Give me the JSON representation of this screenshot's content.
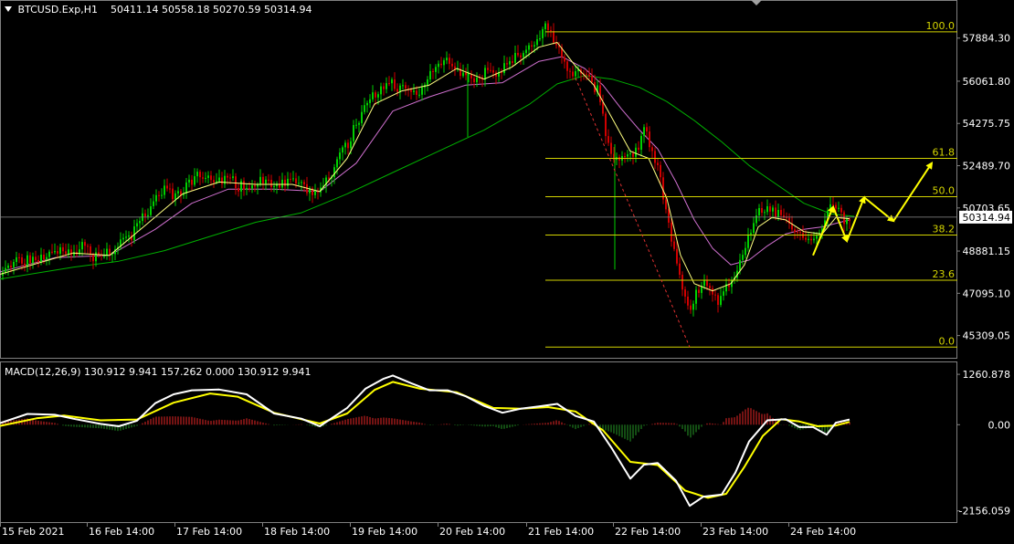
{
  "header": {
    "symbol_text": "BTCUSD.Exp,H1",
    "ohlc_text": "50411.14 50558.18 50270.59 50314.94"
  },
  "macd_header": {
    "text": "MACD(12,26,9) 130.912 9.941 157.262 0.000 130.912 9.941"
  },
  "colors": {
    "background": "#000000",
    "bull": "#00d000",
    "bear": "#d00000",
    "fib": "#d4d400",
    "ma_fast": "#ffff80",
    "ma_mid": "#d070d0",
    "ma_slow": "#00b000",
    "macd_line": "#ffffff",
    "signal_line": "#ffff00",
    "hist_pos": "#c02020",
    "hist_neg": "#208020",
    "grid_border": "#808080",
    "arrow": "#ffff00"
  },
  "chart_data": [
    {
      "type": "line",
      "name": "price",
      "ylim": [
        44600,
        58800
      ],
      "y_ticks": [
        "57884.30",
        "56061.80",
        "54275.75",
        "52489.70",
        "50703.65",
        "48881.15",
        "47095.10",
        "45309.05"
      ],
      "current_price": "50314.94",
      "x_tick_labels": [
        "15 Feb 2021",
        "16 Feb 14:00",
        "17 Feb 14:00",
        "18 Feb 14:00",
        "19 Feb 14:00",
        "20 Feb 14:00",
        "21 Feb 14:00",
        "22 Feb 14:00",
        "23 Feb 14:00",
        "24 Feb 14:00"
      ],
      "price_path": [
        [
          0,
          47800
        ],
        [
          10,
          48300
        ],
        [
          20,
          48600
        ],
        [
          30,
          48450
        ],
        [
          40,
          48350
        ],
        [
          50,
          48800
        ],
        [
          60,
          49050
        ],
        [
          70,
          48950
        ],
        [
          80,
          48850
        ],
        [
          90,
          49100
        ],
        [
          100,
          48700
        ],
        [
          110,
          48550
        ],
        [
          120,
          48850
        ],
        [
          130,
          49200
        ],
        [
          140,
          49350
        ],
        [
          150,
          49850
        ],
        [
          160,
          50500
        ],
        [
          170,
          51100
        ],
        [
          180,
          51400
        ],
        [
          190,
          51250
        ],
        [
          200,
          51450
        ],
        [
          210,
          51800
        ],
        [
          220,
          52100
        ],
        [
          230,
          51850
        ],
        [
          240,
          51900
        ],
        [
          250,
          51950
        ],
        [
          260,
          51650
        ],
        [
          270,
          51600
        ],
        [
          280,
          51750
        ],
        [
          290,
          51900
        ],
        [
          300,
          51800
        ],
        [
          310,
          51650
        ],
        [
          320,
          51750
        ],
        [
          330,
          51600
        ],
        [
          340,
          51300
        ],
        [
          350,
          51550
        ],
        [
          360,
          52000
        ],
        [
          370,
          52700
        ],
        [
          380,
          53400
        ],
        [
          390,
          54200
        ],
        [
          400,
          55000
        ],
        [
          410,
          55500
        ],
        [
          420,
          55800
        ],
        [
          430,
          56000
        ],
        [
          440,
          55700
        ],
        [
          450,
          55500
        ],
        [
          460,
          55700
        ],
        [
          470,
          56300
        ],
        [
          480,
          56700
        ],
        [
          490,
          56850
        ],
        [
          500,
          56600
        ],
        [
          510,
          56100
        ],
        [
          520,
          56250
        ],
        [
          530,
          56400
        ],
        [
          540,
          56500
        ],
        [
          550,
          56550
        ],
        [
          560,
          56900
        ],
        [
          570,
          57300
        ],
        [
          580,
          57500
        ],
        [
          590,
          57800
        ],
        [
          597,
          58300
        ],
        [
          605,
          57850
        ],
        [
          615,
          57100
        ],
        [
          625,
          56500
        ],
        [
          635,
          56250
        ],
        [
          645,
          56200
        ],
        [
          655,
          55600
        ],
        [
          665,
          53500
        ],
        [
          675,
          52700
        ],
        [
          685,
          53100
        ],
        [
          695,
          52900
        ],
        [
          705,
          53900
        ],
        [
          715,
          53200
        ],
        [
          725,
          51500
        ],
        [
          735,
          49500
        ],
        [
          745,
          47500
        ],
        [
          755,
          46500
        ],
        [
          765,
          47200
        ],
        [
          775,
          47700
        ],
        [
          785,
          46800
        ],
        [
          795,
          47400
        ],
        [
          805,
          47900
        ],
        [
          815,
          49000
        ],
        [
          825,
          50300
        ],
        [
          835,
          50800
        ],
        [
          845,
          50600
        ],
        [
          855,
          50400
        ],
        [
          865,
          50100
        ],
        [
          875,
          49700
        ],
        [
          885,
          49500
        ],
        [
          895,
          49300
        ],
        [
          905,
          50600
        ],
        [
          915,
          50700
        ],
        [
          925,
          50000
        ],
        [
          935,
          50300
        ]
      ],
      "ma_fast_path": [
        [
          0,
          47900
        ],
        [
          40,
          48350
        ],
        [
          80,
          48800
        ],
        [
          120,
          48700
        ],
        [
          160,
          50000
        ],
        [
          200,
          51300
        ],
        [
          240,
          51800
        ],
        [
          280,
          51700
        ],
        [
          320,
          51700
        ],
        [
          350,
          51400
        ],
        [
          380,
          52800
        ],
        [
          410,
          55100
        ],
        [
          440,
          55650
        ],
        [
          470,
          55900
        ],
        [
          500,
          56600
        ],
        [
          530,
          56150
        ],
        [
          560,
          56650
        ],
        [
          590,
          57500
        ],
        [
          610,
          57700
        ],
        [
          630,
          56700
        ],
        [
          650,
          55900
        ],
        [
          670,
          54500
        ],
        [
          690,
          53100
        ],
        [
          710,
          52800
        ],
        [
          730,
          51100
        ],
        [
          745,
          48700
        ],
        [
          760,
          47500
        ],
        [
          780,
          47200
        ],
        [
          800,
          47500
        ],
        [
          815,
          48300
        ],
        [
          830,
          49900
        ],
        [
          845,
          50300
        ],
        [
          860,
          50200
        ],
        [
          880,
          49700
        ],
        [
          900,
          49600
        ],
        [
          915,
          50300
        ],
        [
          930,
          50250
        ]
      ],
      "ma_mid_path": [
        [
          0,
          48000
        ],
        [
          60,
          48600
        ],
        [
          120,
          48700
        ],
        [
          170,
          49800
        ],
        [
          210,
          50900
        ],
        [
          250,
          51500
        ],
        [
          300,
          51500
        ],
        [
          350,
          51400
        ],
        [
          390,
          52600
        ],
        [
          430,
          54800
        ],
        [
          470,
          55400
        ],
        [
          510,
          55900
        ],
        [
          550,
          56000
        ],
        [
          590,
          56900
        ],
        [
          615,
          57100
        ],
        [
          640,
          56600
        ],
        [
          660,
          55900
        ],
        [
          680,
          54900
        ],
        [
          700,
          54000
        ],
        [
          720,
          53200
        ],
        [
          740,
          51800
        ],
        [
          760,
          50200
        ],
        [
          780,
          49000
        ],
        [
          800,
          48300
        ],
        [
          820,
          48500
        ],
        [
          840,
          49100
        ],
        [
          860,
          49600
        ],
        [
          880,
          49800
        ],
        [
          900,
          49900
        ],
        [
          930,
          50200
        ]
      ],
      "ma_slow_path": [
        [
          0,
          47700
        ],
        [
          80,
          48200
        ],
        [
          130,
          48450
        ],
        [
          180,
          48900
        ],
        [
          230,
          49500
        ],
        [
          280,
          50100
        ],
        [
          330,
          50500
        ],
        [
          380,
          51300
        ],
        [
          430,
          52200
        ],
        [
          480,
          53100
        ],
        [
          530,
          54000
        ],
        [
          580,
          55100
        ],
        [
          610,
          55950
        ],
        [
          640,
          56300
        ],
        [
          670,
          56150
        ],
        [
          700,
          55800
        ],
        [
          730,
          55200
        ],
        [
          760,
          54400
        ],
        [
          790,
          53500
        ],
        [
          820,
          52500
        ],
        [
          850,
          51700
        ],
        [
          880,
          50900
        ],
        [
          910,
          50450
        ],
        [
          935,
          50350
        ]
      ],
      "fib_retracement": {
        "x_start": 597,
        "x_end": 1048,
        "levels": [
          {
            "label": "100.0",
            "price": 58150
          },
          {
            "label": "61.8",
            "price": 52800
          },
          {
            "label": "50.0",
            "price": 51180
          },
          {
            "label": "38.2",
            "price": 49560
          },
          {
            "label": "23.6",
            "price": 47650
          },
          {
            "label": "0.0",
            "price": 44820
          }
        ],
        "trendline": {
          "x1": 630,
          "p1": 56200,
          "x2": 755,
          "p2": 44820
        }
      },
      "projection_arrows": [
        {
          "x1": 890,
          "p1": 48700,
          "x2": 912,
          "p2": 50750
        },
        {
          "x1": 912,
          "p1": 50750,
          "x2": 927,
          "p2": 49300
        },
        {
          "x1": 927,
          "p1": 49300,
          "x2": 946,
          "p2": 51150
        },
        {
          "x1": 946,
          "p1": 51150,
          "x2": 978,
          "p2": 50150
        },
        {
          "x1": 978,
          "p1": 50150,
          "x2": 1020,
          "p2": 52600
        }
      ]
    },
    {
      "type": "line",
      "name": "MACD(12,26,9)",
      "ylim": [
        -2300,
        1400
      ],
      "y_ticks": [
        "1260.878",
        "0.00",
        "-2156.059"
      ],
      "macd_path": [
        [
          0,
          40
        ],
        [
          30,
          270
        ],
        [
          60,
          250
        ],
        [
          80,
          150
        ],
        [
          110,
          20
        ],
        [
          130,
          -40
        ],
        [
          150,
          100
        ],
        [
          170,
          540
        ],
        [
          190,
          760
        ],
        [
          210,
          860
        ],
        [
          240,
          880
        ],
        [
          270,
          760
        ],
        [
          300,
          280
        ],
        [
          330,
          150
        ],
        [
          350,
          -40
        ],
        [
          380,
          420
        ],
        [
          400,
          900
        ],
        [
          420,
          1150
        ],
        [
          430,
          1230
        ],
        [
          450,
          1040
        ],
        [
          470,
          860
        ],
        [
          490,
          860
        ],
        [
          510,
          710
        ],
        [
          530,
          470
        ],
        [
          550,
          300
        ],
        [
          570,
          400
        ],
        [
          590,
          460
        ],
        [
          610,
          520
        ],
        [
          630,
          220
        ],
        [
          650,
          80
        ],
        [
          670,
          -600
        ],
        [
          690,
          -1350
        ],
        [
          705,
          -1000
        ],
        [
          720,
          -960
        ],
        [
          740,
          -1400
        ],
        [
          755,
          -2030
        ],
        [
          770,
          -1800
        ],
        [
          790,
          -1750
        ],
        [
          805,
          -1200
        ],
        [
          820,
          -420
        ],
        [
          840,
          110
        ],
        [
          860,
          140
        ],
        [
          875,
          -60
        ],
        [
          890,
          -60
        ],
        [
          905,
          -250
        ],
        [
          915,
          50
        ],
        [
          930,
          130
        ]
      ],
      "signal_path": [
        [
          0,
          -30
        ],
        [
          40,
          160
        ],
        [
          70,
          230
        ],
        [
          110,
          110
        ],
        [
          150,
          130
        ],
        [
          190,
          550
        ],
        [
          230,
          780
        ],
        [
          260,
          700
        ],
        [
          300,
          300
        ],
        [
          350,
          30
        ],
        [
          380,
          280
        ],
        [
          410,
          870
        ],
        [
          430,
          1070
        ],
        [
          460,
          900
        ],
        [
          500,
          810
        ],
        [
          540,
          420
        ],
        [
          570,
          400
        ],
        [
          600,
          440
        ],
        [
          630,
          330
        ],
        [
          660,
          -140
        ],
        [
          690,
          -930
        ],
        [
          720,
          -1010
        ],
        [
          750,
          -1650
        ],
        [
          775,
          -1830
        ],
        [
          795,
          -1730
        ],
        [
          815,
          -1050
        ],
        [
          835,
          -280
        ],
        [
          855,
          140
        ],
        [
          875,
          80
        ],
        [
          895,
          -40
        ],
        [
          915,
          -20
        ],
        [
          930,
          70
        ]
      ]
    }
  ]
}
